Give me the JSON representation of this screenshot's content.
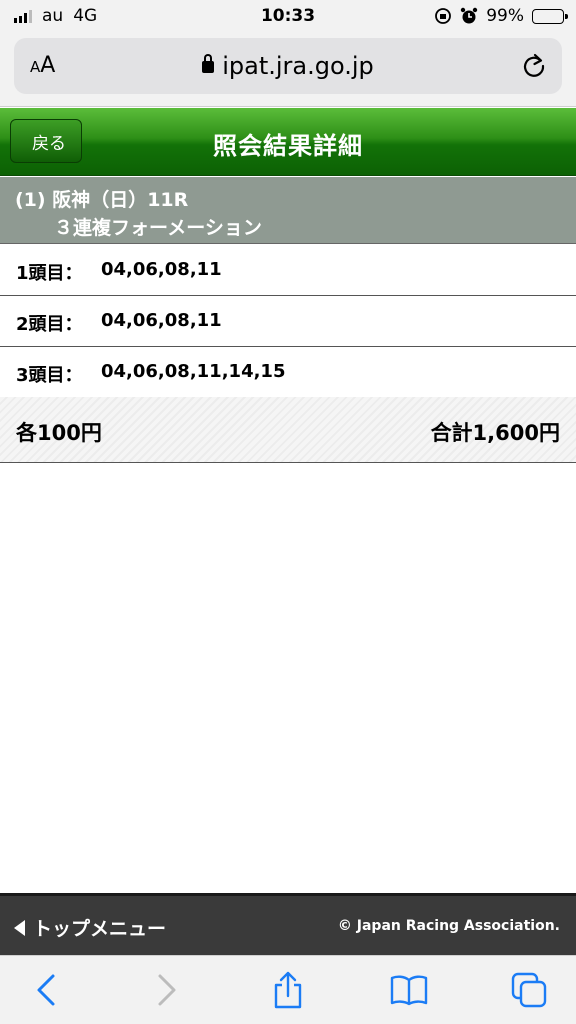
{
  "status": {
    "carrier": "au",
    "network": "4G",
    "time": "10:33",
    "battery": "99%",
    "battery_level": 0.99
  },
  "browser": {
    "text_size": "AA",
    "url": "ipat.jra.go.jp"
  },
  "header": {
    "back_label": "戻る",
    "title": "照会結果詳細"
  },
  "race": {
    "line1": "(1) 阪神（日）11R",
    "line2": "３連複フォーメーション"
  },
  "selections": [
    {
      "label": "1頭目：",
      "value": "04,06,08,11"
    },
    {
      "label": "2頭目：",
      "value": "04,06,08,11"
    },
    {
      "label": "3頭目：",
      "value": "04,06,08,11,14,15"
    }
  ],
  "summary": {
    "each": "各100円",
    "total": "合計1,600円"
  },
  "footer": {
    "top_menu": "トップメニュー",
    "copyright": "© Japan Racing Association."
  },
  "toolbar_icons": [
    "back-icon",
    "forward-icon",
    "share-icon",
    "bookmarks-icon",
    "tabs-icon"
  ],
  "colors": {
    "header_green": "#137208",
    "race_bar": "#8f9a92",
    "footer": "#3a3a3a",
    "safari_blue": "#1b7cf5"
  }
}
